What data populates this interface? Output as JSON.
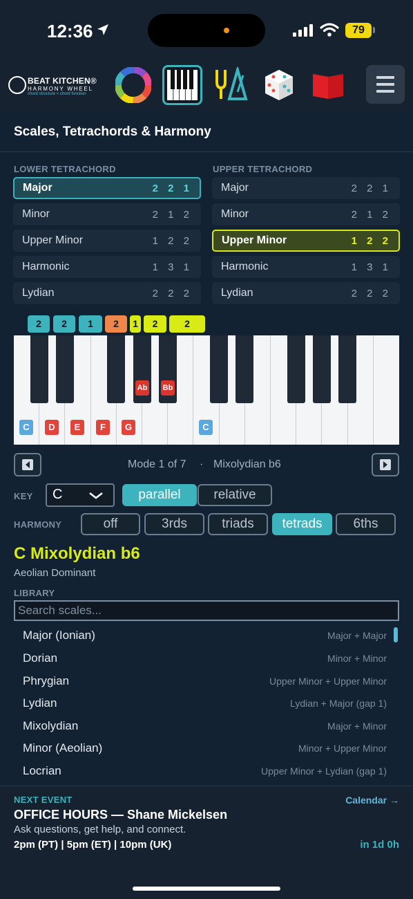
{
  "status": {
    "time": "12:36",
    "battery": "79"
  },
  "app": {
    "logo_title": "BEAT KITCHEN®",
    "logo_sub": "HARMONY WHEEL",
    "logo_tag": "chord structure < chord function"
  },
  "panel": {
    "title": "Scales, Tetrachords & Harmony",
    "lower_label": "LOWER TETRACHORD",
    "upper_label": "UPPER TETRACHORD",
    "lower": [
      {
        "name": "Major",
        "steps": "2 2 1"
      },
      {
        "name": "Minor",
        "steps": "2 1 2"
      },
      {
        "name": "Upper Minor",
        "steps": "1 2 2"
      },
      {
        "name": "Harmonic",
        "steps": "1 3 1"
      },
      {
        "name": "Lydian",
        "steps": "2 2 2"
      }
    ],
    "upper": [
      {
        "name": "Major",
        "steps": "2 2 1"
      },
      {
        "name": "Minor",
        "steps": "2 1 2"
      },
      {
        "name": "Upper Minor",
        "steps": "1 2 2"
      },
      {
        "name": "Harmonic",
        "steps": "1 3 1"
      },
      {
        "name": "Lydian",
        "steps": "2 2 2"
      }
    ],
    "step_badges": [
      "2",
      "2",
      "1",
      "2",
      "1",
      "2",
      "2"
    ],
    "note_labels": [
      "C",
      "D",
      "E",
      "F",
      "G",
      "Ab",
      "Bb",
      "C"
    ],
    "mode_text": "Mode 1 of 7",
    "mode_sep": "·",
    "mode_name": "Mixolydian b6",
    "key_label": "KEY",
    "key_value": "C",
    "parallel": "parallel",
    "relative": "relative",
    "harmony_label": "HARMONY",
    "harmony_options": [
      "off",
      "3rds",
      "triads",
      "tetrads",
      "6ths"
    ],
    "scale_title": "C  Mixolydian b6",
    "scale_alt": "Aeolian Dominant",
    "library_label": "LIBRARY",
    "search_placeholder": "Search scales...",
    "library": [
      {
        "name": "Major (Ionian)",
        "formula": "Major + Major"
      },
      {
        "name": "Dorian",
        "formula": "Minor + Minor"
      },
      {
        "name": "Phrygian",
        "formula": "Upper Minor + Upper Minor"
      },
      {
        "name": "Lydian",
        "formula": "Lydian + Major (gap 1)"
      },
      {
        "name": "Mixolydian",
        "formula": "Major + Minor"
      },
      {
        "name": "Minor (Aeolian)",
        "formula": "Minor + Upper Minor"
      },
      {
        "name": "Locrian",
        "formula": "Upper Minor + Lydian (gap 1)"
      }
    ]
  },
  "event": {
    "label": "NEXT EVENT",
    "calendar": "Calendar →",
    "title": "OFFICE HOURS  —  Shane Mickelsen",
    "desc": "Ask questions, get help, and connect.",
    "times": "2pm (PT) | 5pm (ET) | 10pm (UK)",
    "countdown": "in 1d 0h"
  },
  "colors": {
    "accent_teal": "#3cb3bd",
    "accent_yellow": "#d8eb14",
    "accent_orange": "#f0874a",
    "note_red": "#e0443a",
    "note_blue": "#5aa8dc"
  }
}
